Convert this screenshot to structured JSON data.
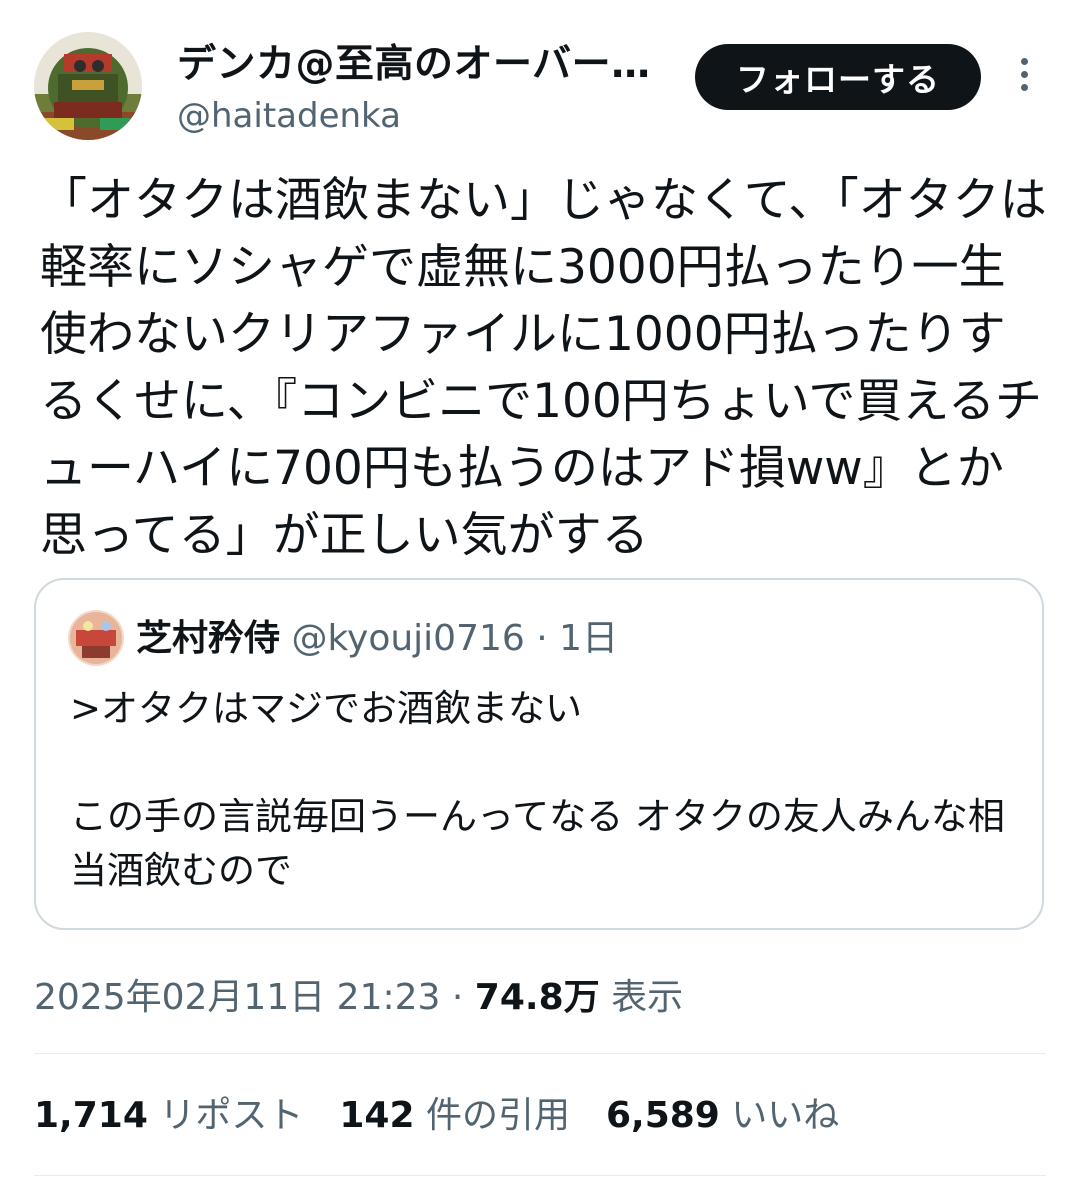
{
  "author": {
    "display_name": "デンカ@至高のオーバー…",
    "handle": "@haitadenka"
  },
  "follow_button": {
    "label": "フォローする"
  },
  "tweet": {
    "text": "「オタクは酒飲まない」じゃなくて、「オタクは軽率にソシャゲで虚無に3000円払ったり一生使わないクリアファイルに1000円払ったりするくせに、『コンビニで100円ちょいで買えるチューハイに700円も払うのはアド損ww』とか思ってる」が正しい気がする"
  },
  "quoted_tweet": {
    "name": "芝村矜侍",
    "handle": "@kyouji0716",
    "separator": "·",
    "time": "1日",
    "text": ">オタクはマジでお酒飲まない\n\nこの手の言説毎回うーんってなる オタクの友人みんな相当酒飲むので"
  },
  "meta": {
    "timestamp": "2025年02月11日 21:23",
    "separator": "·",
    "views_count": "74.8万",
    "views_label": "表示"
  },
  "stats": {
    "reposts_count": "1,714",
    "reposts_label": "リポスト",
    "quotes_count": "142",
    "quotes_label": "件の引用",
    "likes_count": "6,589",
    "likes_label": "いいね"
  },
  "icons": {
    "more": "more-vertical-icon",
    "avatar": "author-avatar",
    "quote_avatar": "quote-author-avatar"
  },
  "colors": {
    "text_primary": "#0f1419",
    "text_secondary": "#536471",
    "border": "#cfd9de",
    "follow_bg": "#0f1419"
  }
}
